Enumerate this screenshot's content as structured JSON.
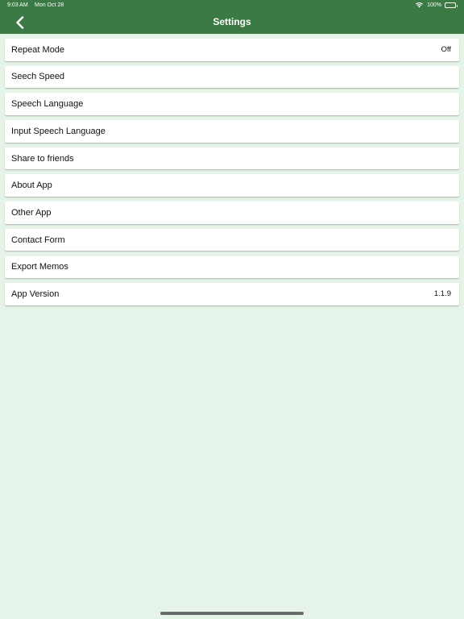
{
  "status_bar": {
    "time": "9:03 AM",
    "date": "Mon Oct 28",
    "battery": "100%"
  },
  "nav": {
    "title": "Settings",
    "back_icon": "chevron-left-icon"
  },
  "colors": {
    "header": "#3b7a45",
    "background": "#e6f3e8",
    "row": "#ffffff"
  },
  "settings": {
    "items": [
      {
        "label": "Repeat Mode",
        "value": "Off"
      },
      {
        "label": "Seech Speed",
        "value": ""
      },
      {
        "label": "Speech Language",
        "value": ""
      },
      {
        "label": "Input Speech Language",
        "value": ""
      },
      {
        "label": "Share to friends",
        "value": ""
      },
      {
        "label": "About App",
        "value": ""
      },
      {
        "label": "Other App",
        "value": ""
      },
      {
        "label": "Contact Form",
        "value": ""
      },
      {
        "label": "Export Memos",
        "value": ""
      },
      {
        "label": "App Version",
        "value": "1.1.9"
      }
    ]
  }
}
